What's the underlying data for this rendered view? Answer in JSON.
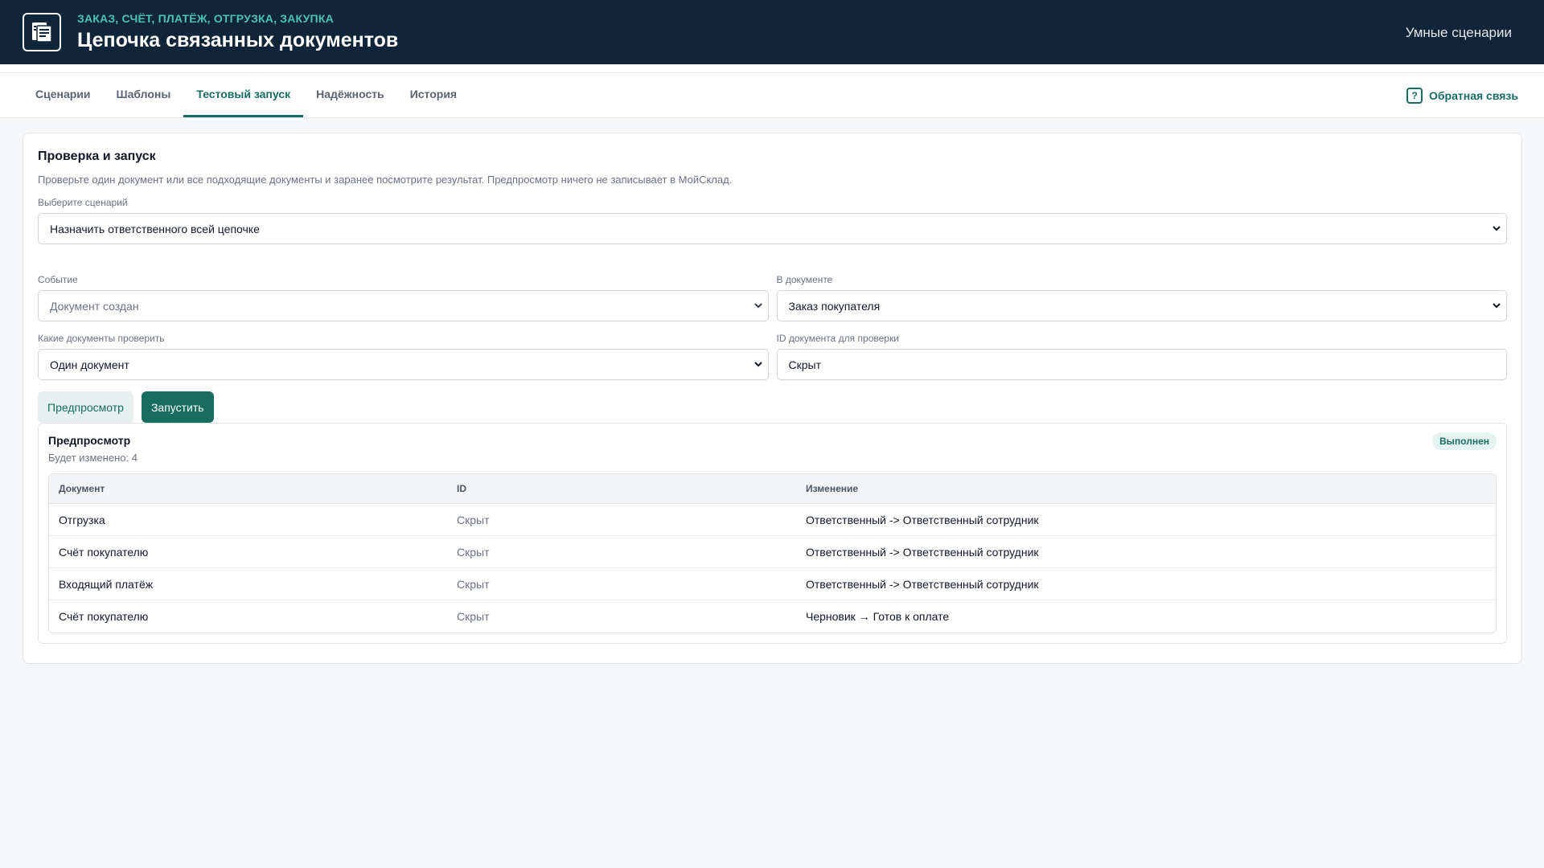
{
  "header": {
    "subtitle": "ЗАКАЗ, СЧЁТ, ПЛАТЁЖ, ОТГРУЗКА, ЗАКУПКА",
    "title": "Цепочка связанных документов",
    "right_link": "Умные сценарии",
    "logo_icon": "document-icon"
  },
  "tabs": {
    "items": [
      {
        "label": "Сценарии"
      },
      {
        "label": "Шаблоны"
      },
      {
        "label": "Тестовый запуск",
        "active": true
      },
      {
        "label": "Надёжность"
      },
      {
        "label": "История"
      }
    ],
    "feedback_label": "Обратная связь",
    "feedback_icon": "question-icon"
  },
  "card": {
    "title": "Проверка и запуск",
    "description": "Проверьте один документ или все подходящие документы и заранее посмотрите результат. Предпросмотр ничего не записывает в МойСклад.",
    "scenario": {
      "label": "Выберите сценарий",
      "value": "Назначить ответственного всей цепочке"
    },
    "event": {
      "label": "Событие",
      "value": "Документ создан"
    },
    "in_document": {
      "label": "В документе",
      "value": "Заказ покупателя"
    },
    "which_docs": {
      "label": "Какие документы проверить",
      "value": "Один документ"
    },
    "doc_id": {
      "label": "ID документа для проверки",
      "value": "Скрыт"
    },
    "preview_button": "Предпросмотр",
    "run_button": "Запустить"
  },
  "preview": {
    "title": "Предпросмотр",
    "count_text": "Будет изменено: 4",
    "status": "Выполнен",
    "columns": [
      "Документ",
      "ID",
      "Изменение"
    ],
    "rows": [
      [
        "Отгрузка",
        "Скрыт",
        "Ответственный -> Ответственный сотрудник"
      ],
      [
        "Счёт покупателю",
        "Скрыт",
        "Ответственный -> Ответственный сотрудник"
      ],
      [
        "Входящий платёж",
        "Скрыт",
        "Ответственный -> Ответственный сотрудник"
      ],
      [
        "Счёт покупателю",
        "Скрыт",
        "Черновик → Готов к оплате"
      ]
    ]
  },
  "colors": {
    "header_bg": "#11253a",
    "accent": "#176d60",
    "subtitle": "#4dc2b0"
  }
}
